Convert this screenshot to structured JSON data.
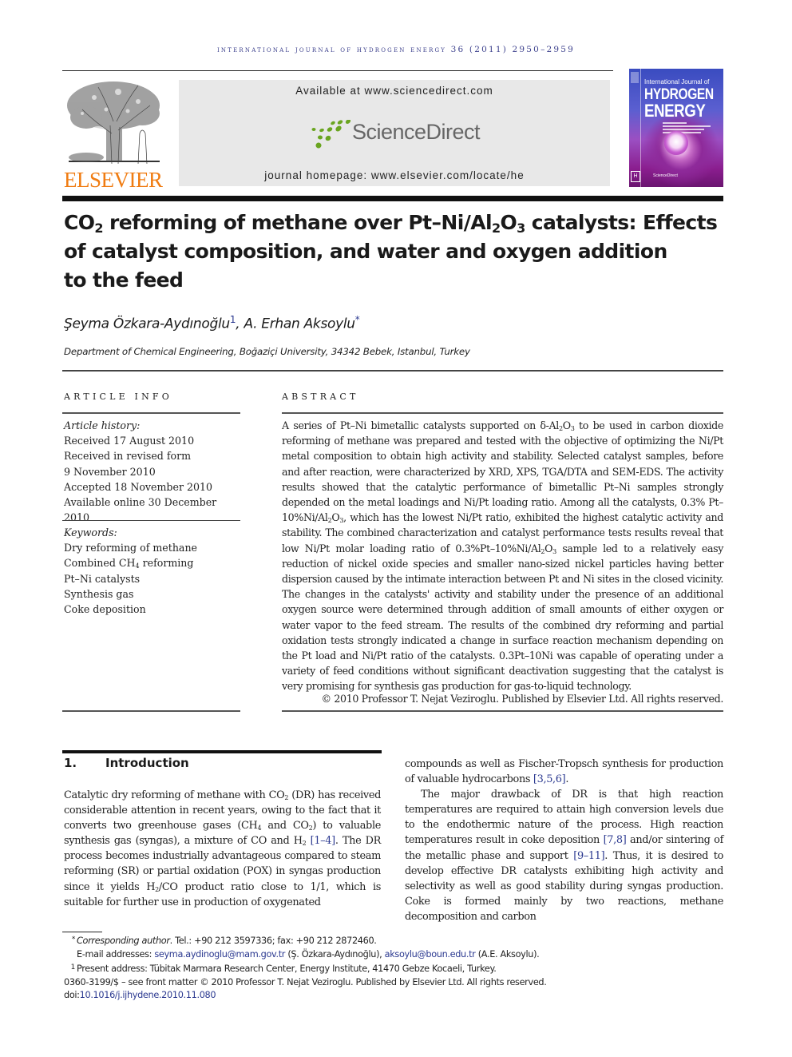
{
  "header": {
    "journal_name": "international journal of hydrogen energy",
    "volume_year_pages": "36 (2011) 2950–2959"
  },
  "publisher": {
    "logo_word": "ELSEVIER",
    "logo_icon": "elsevier-tree-icon",
    "brand_color": "#f07c12"
  },
  "sciencedirect": {
    "available_text": "Available at www.sciencedirect.com",
    "logo_word": "ScienceDirect",
    "logo_icon": "sciencedirect-dots-icon",
    "homepage_text": "journal homepage: www.elsevier.com/locate/he",
    "dot_color": "#6aa520"
  },
  "cover": {
    "small_title": "International Journal of",
    "title_line1": "HYDROGEN",
    "title_line2": "ENERGY",
    "footer_brand": "ScienceDirect",
    "badge": "H"
  },
  "article": {
    "title_parts": {
      "a": "CO",
      "a_sub": "2",
      "b": " reforming of methane over Pt–Ni/Al",
      "b_sub": "2",
      "c": "O",
      "c_sub": "3",
      "d": " catalysts: Effects",
      "line2": "of catalyst composition, and water and oxygen addition",
      "line3": "to the feed"
    },
    "authors": [
      {
        "name": "Şeyma Özkara-Aydınoğlu",
        "mark": "1"
      },
      {
        "name": "A. Erhan Aksoylu",
        "mark": "*"
      }
    ],
    "author_separator": ", ",
    "affiliation": "Department of Chemical Engineering, Boğaziçi University, 34342 Bebek, Istanbul, Turkey"
  },
  "article_info": {
    "label": "ARTICLE INFO",
    "history_label": "Article history:",
    "history": [
      "Received 17 August 2010",
      "Received in revised form",
      "9 November 2010",
      "Accepted 18 November 2010",
      "Available online 30 December 2010"
    ],
    "keywords_label": "Keywords:",
    "keywords": {
      "k1": "Dry reforming of methane",
      "k2_a": "Combined CH",
      "k2_sub": "4",
      "k2_b": " reforming",
      "k3": "Pt–Ni catalysts",
      "k4": "Synthesis gas",
      "k5": "Coke deposition"
    }
  },
  "abstract": {
    "label": "ABSTRACT",
    "p1": "A series of Pt–Ni bimetallic catalysts supported on δ-Al",
    "p1_sub1": "2",
    "p2": "O",
    "p2_sub": "3",
    "p3": " to be used in carbon dioxide reforming of methane was prepared and tested with the objective of optimizing the Ni/Pt metal composition to obtain high activity and stability. Selected catalyst samples, before and after reaction, were characterized by XRD, XPS, TGA/DTA and SEM-EDS. The activity results showed that the catalytic performance of bimetallic Pt–Ni samples strongly depended on the metal loadings and Ni/Pt loading ratio. Among all the catalysts, 0.3% Pt–10%Ni/Al",
    "p3_sub": "2",
    "p4": "O",
    "p4_sub": "3",
    "p5": ", which has the lowest Ni/Pt ratio, exhibited the highest catalytic activity and stability. The combined characterization and catalyst performance tests results reveal that low Ni/Pt molar loading ratio of 0.3%Pt–10%Ni/Al",
    "p5_sub": "2",
    "p6": "O",
    "p6_sub": "3",
    "p7": " sample led to a relatively easy reduction of nickel oxide species and smaller nano-sized nickel particles having better dispersion caused by the intimate interaction between Pt and Ni sites in the closed vicinity. The changes in the catalysts' activity and stability under the presence of an additional oxygen source were determined through addition of small amounts of either oxygen or water vapor to the feed stream. The results of the combined dry reforming and partial oxidation tests strongly indicated a change in surface reaction mechanism depending on the Pt load and Ni/Pt ratio of the catalysts. 0.3Pt–10Ni was capable of operating under a variety of feed conditions without significant deactivation suggesting that the catalyst is very promising for synthesis gas production for gas-to-liquid technology.",
    "copyright": "© 2010 Professor T. Nejat Veziroglu. Published by Elsevier Ltd. All rights reserved."
  },
  "introduction": {
    "number": "1.",
    "heading": "Introduction",
    "left": {
      "s1": "Catalytic dry reforming of methane with CO",
      "s1_sub": "2",
      "s2": " (DR) has received considerable attention in recent years, owing to the fact that it converts two greenhouse gases (CH",
      "s2_sub": "4",
      "s3": " and CO",
      "s3_sub": "2",
      "s4": ") to valuable synthesis gas (syngas), a mixture of CO and H",
      "s4_sub": "2",
      "s5": " ",
      "ref1": "[1–4]",
      "s6": ". The DR process becomes industrially advantageous compared to steam reforming (SR) or partial oxidation (POX) in syngas production since it yields H",
      "s6_sub": "2",
      "s7": "/CO product ratio close to 1/1, which is suitable for further use in production of oxygenated"
    },
    "right": {
      "p1_a": "compounds as well as Fischer-Tropsch synthesis for production of valuable hydrocarbons ",
      "p1_ref": "[3,5,6]",
      "p1_b": ".",
      "p2_a": "The major drawback of DR is that high reaction temperatures are required to attain high conversion levels due to the endothermic nature of the process. High reaction temperatures result in coke deposition ",
      "p2_ref1": "[7,8]",
      "p2_b": " and/or sintering of the metallic phase and support ",
      "p2_ref2": "[9–11]",
      "p2_c": ". Thus, it is desired to develop effective DR catalysts exhibiting high activity and selectivity as well as good stability during syngas production. Coke is formed mainly by two reactions, methane decomposition and carbon"
    }
  },
  "footnotes": {
    "corr_mark": "*",
    "corr_label": "Corresponding author",
    "corr_text": ". Tel.: +90 212 3597336; fax: +90 212 2872460.",
    "email_label": "E-mail addresses: ",
    "email1": "seyma.aydinoglu@mam.gov.tr",
    "email1_owner": " (Ş. Özkara-Aydınoğlu), ",
    "email2": "aksoylu@boun.edu.tr",
    "email2_owner": " (A.E. Aksoylu).",
    "present_mark": "1",
    "present_text": "Present address: Tübitak Marmara Research Center, Energy Institute, 41470 Gebze Kocaeli, Turkey.",
    "front_matter": "0360-3199/$ – see front matter © 2010 Professor T. Nejat Veziroglu. Published by Elsevier Ltd. All rights reserved.",
    "doi_label": "doi:",
    "doi": "10.1016/j.ijhydene.2010.11.080"
  }
}
